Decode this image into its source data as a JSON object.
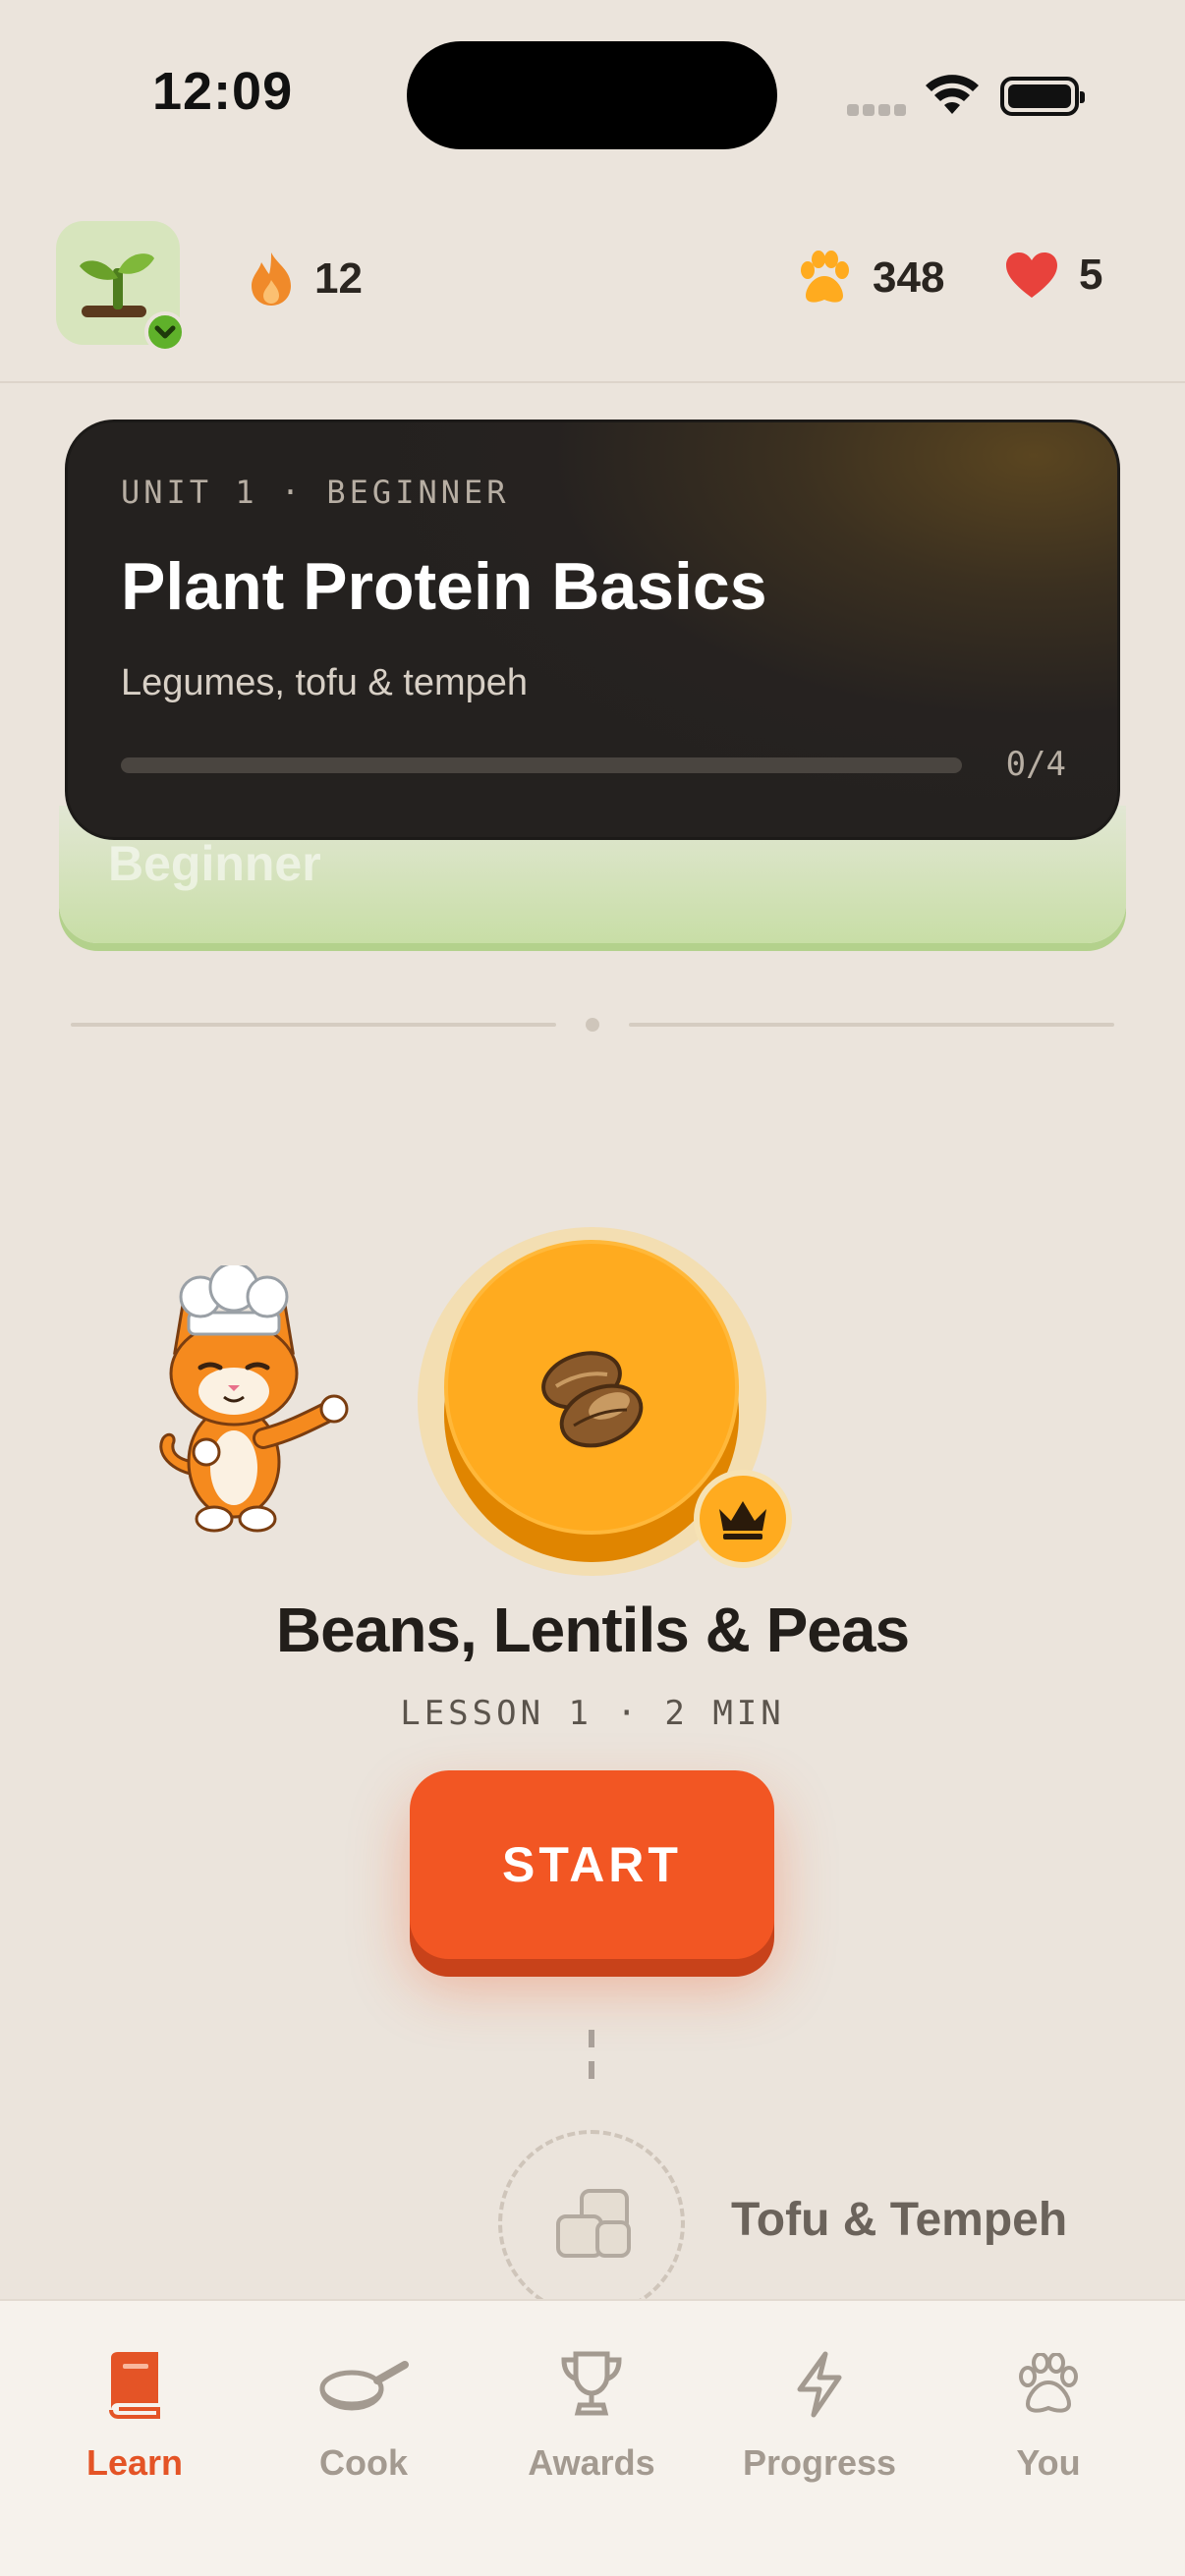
{
  "status_bar": {
    "time": "12:09"
  },
  "header": {
    "streak": "12",
    "paws": "348",
    "hearts": "5"
  },
  "unit": {
    "eyebrow": "UNIT 1 · BEGINNER",
    "title": "Plant Protein Basics",
    "subtitle": "Legumes, tofu & tempeh",
    "progress_label": "0/4",
    "progress": 0,
    "ghost_label": "Beginner"
  },
  "lesson": {
    "title": "Beans, Lentils & Peas",
    "meta": "LESSON 1 · 2 MIN",
    "start_label": "START"
  },
  "next_lesson": {
    "title": "Tofu & Tempeh"
  },
  "tabs": [
    {
      "label": "Learn",
      "icon": "book-icon",
      "active": true
    },
    {
      "label": "Cook",
      "icon": "pan-icon",
      "active": false
    },
    {
      "label": "Awards",
      "icon": "trophy-icon",
      "active": false
    },
    {
      "label": "Progress",
      "icon": "lightning-icon",
      "active": false
    },
    {
      "label": "You",
      "icon": "paw-icon",
      "active": false
    }
  ],
  "colors": {
    "background": "#ebe4dc",
    "accent": "#f25623",
    "lesson_node": "#ffab1f",
    "active_tab": "#e45426",
    "inactive_tab": "#a39a90"
  }
}
